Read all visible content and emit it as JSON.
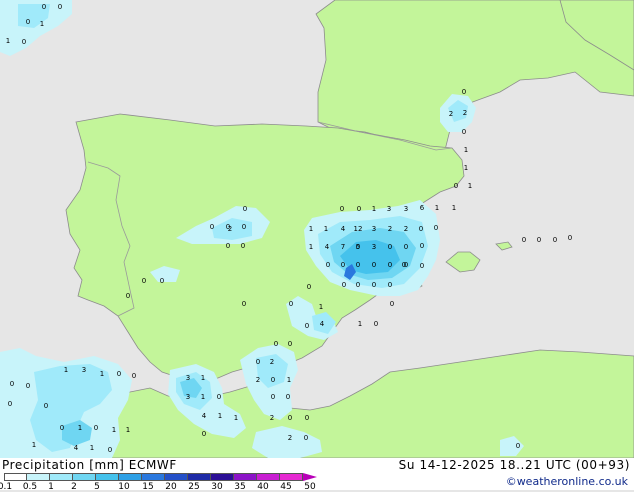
{
  "title": {
    "label": "Precipitation [mm]",
    "model": "ECMWF",
    "valid": "Su 14-12-2025 18..21 UTC (00+93)"
  },
  "copyright": "©weatheronline.co.uk",
  "legend": {
    "ticks": [
      "0.1",
      "0.5",
      "1",
      "2",
      "5",
      "10",
      "15",
      "20",
      "25",
      "30",
      "35",
      "40",
      "45",
      "50"
    ],
    "colors": [
      "#ffffff",
      "#c8f4fa",
      "#a0eafa",
      "#6fd6f2",
      "#45c2ec",
      "#2ea0e6",
      "#2a78de",
      "#2450c8",
      "#1e2aa6",
      "#2c0f96",
      "#8c14c8",
      "#c81ed2",
      "#e628d2",
      "#b800b8"
    ]
  },
  "colors": {
    "sea": "#e6e6e6",
    "land": "#c3f59a",
    "coast": "#8c8c8c",
    "border": "#9a9a9a"
  },
  "stations": [
    {
      "id": "s1",
      "v": "0"
    },
    {
      "id": "s2",
      "v": "0"
    },
    {
      "id": "s3",
      "v": "0"
    },
    {
      "id": "s4",
      "v": "1"
    },
    {
      "id": "s5",
      "v": "1"
    },
    {
      "id": "s6",
      "v": "0"
    },
    {
      "id": "s7",
      "v": "0"
    },
    {
      "id": "s8",
      "v": "2"
    },
    {
      "id": "s9",
      "v": "2"
    },
    {
      "id": "s10",
      "v": "1"
    },
    {
      "id": "s11",
      "v": "1"
    },
    {
      "id": "s12",
      "v": "0"
    },
    {
      "id": "s13",
      "v": "1"
    },
    {
      "id": "s14",
      "v": "0"
    },
    {
      "id": "s15",
      "v": "0"
    },
    {
      "id": "s16",
      "v": "0"
    },
    {
      "id": "s17",
      "v": "0"
    },
    {
      "id": "s18",
      "v": "0"
    },
    {
      "id": "s19",
      "v": "2"
    },
    {
      "id": "s20",
      "v": "0"
    },
    {
      "id": "s21",
      "v": "0"
    },
    {
      "id": "s22",
      "v": "0"
    },
    {
      "id": "s23",
      "v": "0"
    },
    {
      "id": "s24",
      "v": "1"
    },
    {
      "id": "s25",
      "v": "3"
    },
    {
      "id": "s26",
      "v": "3"
    },
    {
      "id": "s27",
      "v": "6"
    },
    {
      "id": "s28",
      "v": "1"
    },
    {
      "id": "s29",
      "v": "1"
    },
    {
      "id": "s30",
      "v": "1"
    },
    {
      "id": "s31",
      "v": "1"
    },
    {
      "id": "s32",
      "v": "4"
    },
    {
      "id": "s33",
      "v": "12"
    },
    {
      "id": "s34",
      "v": "3"
    },
    {
      "id": "s35",
      "v": "2"
    },
    {
      "id": "s36",
      "v": "2"
    },
    {
      "id": "s37",
      "v": "0"
    },
    {
      "id": "s38",
      "v": "0"
    },
    {
      "id": "s39",
      "v": "1"
    },
    {
      "id": "s40",
      "v": "4"
    },
    {
      "id": "s41",
      "v": "7"
    },
    {
      "id": "s42",
      "v": "0"
    },
    {
      "id": "s43",
      "v": "3"
    },
    {
      "id": "s44",
      "v": "0"
    },
    {
      "id": "s45",
      "v": "0"
    },
    {
      "id": "s46",
      "v": "0"
    },
    {
      "id": "s47",
      "v": "5"
    },
    {
      "id": "s48",
      "v": "0"
    },
    {
      "id": "s49",
      "v": "0"
    },
    {
      "id": "s50",
      "v": "0"
    },
    {
      "id": "s51",
      "v": "0"
    },
    {
      "id": "s52",
      "v": "0"
    },
    {
      "id": "s53",
      "v": "0"
    },
    {
      "id": "s54",
      "v": "0"
    },
    {
      "id": "s55",
      "v": "0"
    },
    {
      "id": "s56",
      "v": "0"
    },
    {
      "id": "s57",
      "v": "0"
    },
    {
      "id": "s58",
      "v": "0"
    },
    {
      "id": "s59",
      "v": "0"
    },
    {
      "id": "s60",
      "v": "0"
    },
    {
      "id": "s61",
      "v": "0"
    },
    {
      "id": "s62",
      "v": "0"
    },
    {
      "id": "s63",
      "v": "0"
    },
    {
      "id": "s64",
      "v": "0"
    },
    {
      "id": "s65",
      "v": "1"
    },
    {
      "id": "s66",
      "v": "0"
    },
    {
      "id": "s67",
      "v": "4"
    },
    {
      "id": "s68",
      "v": "0"
    },
    {
      "id": "s69",
      "v": "1"
    },
    {
      "id": "s70",
      "v": "0"
    },
    {
      "id": "s71",
      "v": "0"
    },
    {
      "id": "s72",
      "v": "0"
    },
    {
      "id": "s73",
      "v": "2"
    },
    {
      "id": "s74",
      "v": "0"
    },
    {
      "id": "s75",
      "v": "0"
    },
    {
      "id": "s76",
      "v": "0"
    },
    {
      "id": "s77",
      "v": "3"
    },
    {
      "id": "s78",
      "v": "1"
    },
    {
      "id": "s79",
      "v": "2"
    },
    {
      "id": "s80",
      "v": "0"
    },
    {
      "id": "s81",
      "v": "1"
    },
    {
      "id": "s82",
      "v": "3"
    },
    {
      "id": "s83",
      "v": "1"
    },
    {
      "id": "s84",
      "v": "0"
    },
    {
      "id": "s85",
      "v": "4"
    },
    {
      "id": "s86",
      "v": "1"
    },
    {
      "id": "s87",
      "v": "1"
    },
    {
      "id": "s88",
      "v": "0"
    },
    {
      "id": "s89",
      "v": "0"
    },
    {
      "id": "s90",
      "v": "2"
    },
    {
      "id": "s91",
      "v": "0"
    },
    {
      "id": "s92",
      "v": "0"
    },
    {
      "id": "s93",
      "v": "1"
    },
    {
      "id": "s94",
      "v": "3"
    },
    {
      "id": "s95",
      "v": "1"
    },
    {
      "id": "s96",
      "v": "0"
    },
    {
      "id": "s97",
      "v": "0"
    },
    {
      "id": "s98",
      "v": "0"
    },
    {
      "id": "s99",
      "v": "0"
    },
    {
      "id": "s100",
      "v": "0"
    },
    {
      "id": "s101",
      "v": "0"
    },
    {
      "id": "s102",
      "v": "1"
    },
    {
      "id": "s103",
      "v": "0"
    },
    {
      "id": "s104",
      "v": "1"
    },
    {
      "id": "s105",
      "v": "1"
    },
    {
      "id": "s106",
      "v": "0"
    },
    {
      "id": "s107",
      "v": "1"
    },
    {
      "id": "s108",
      "v": "4"
    },
    {
      "id": "s109",
      "v": "1"
    },
    {
      "id": "s110",
      "v": "0"
    },
    {
      "id": "s111",
      "v": "0"
    },
    {
      "id": "s112",
      "v": "2"
    },
    {
      "id": "s113",
      "v": "0"
    },
    {
      "id": "s114",
      "v": "0"
    },
    {
      "id": "s115",
      "v": "0"
    },
    {
      "id": "s116",
      "v": "0"
    },
    {
      "id": "s117",
      "v": "0"
    }
  ]
}
